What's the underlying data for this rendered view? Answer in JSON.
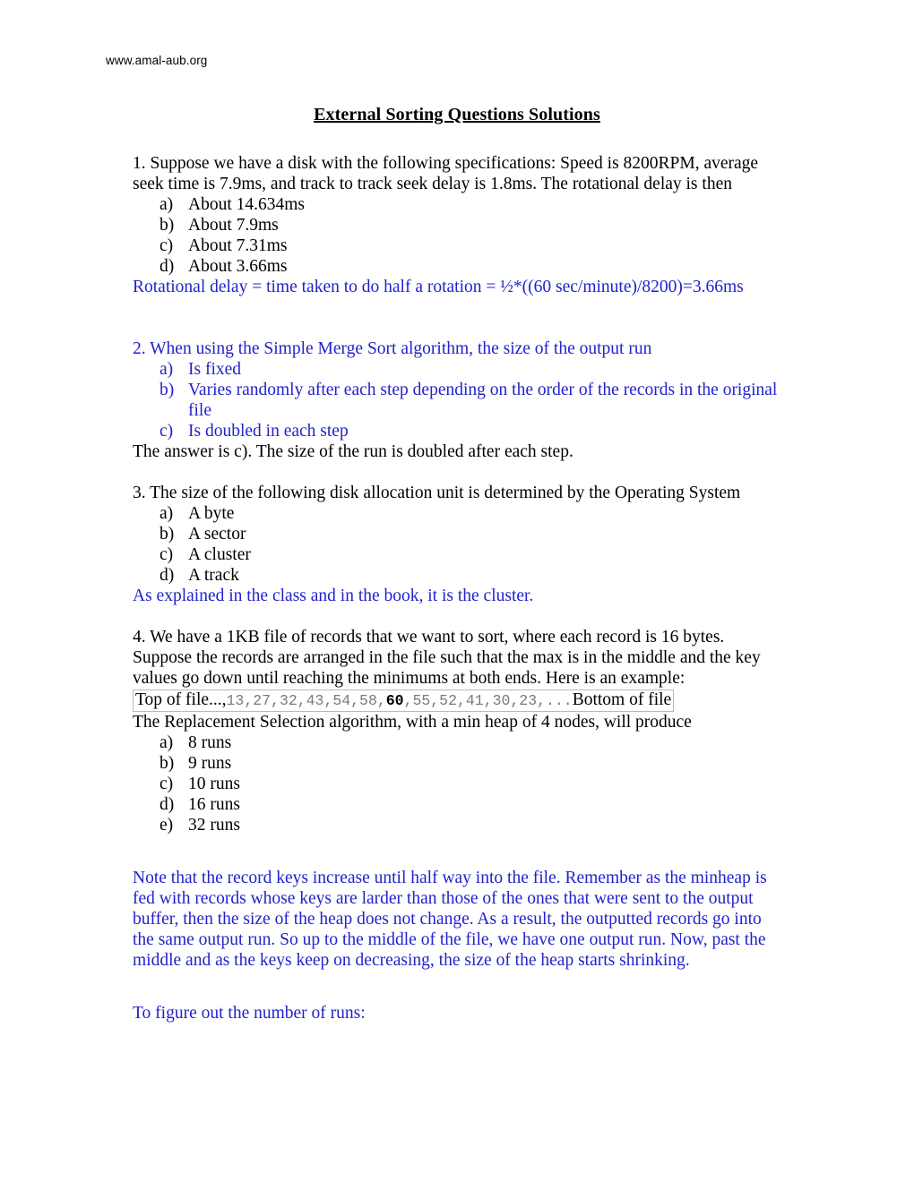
{
  "header": {
    "site_url": "www.amal-aub.org"
  },
  "document": {
    "title": "External Sorting Questions Solutions"
  },
  "colors": {
    "answer_blue": "#2222cc",
    "body_black": "#000000",
    "mono_gray": "#7a7a7a",
    "box_border": "#b9b9b9",
    "page_background": "#ffffff"
  },
  "questions": [
    {
      "number": "1",
      "stem": "1. Suppose we have a disk with the following specifications: Speed is 8200RPM, average seek time is 7.9ms, and track to track seek delay is 1.8ms. The rotational delay is then",
      "stem_color": "black",
      "choices": [
        {
          "marker": "a)",
          "text": "About 14.634ms",
          "color": "black"
        },
        {
          "marker": "b)",
          "text": "About 7.9ms",
          "color": "black"
        },
        {
          "marker": "c)",
          "text": "About 7.31ms",
          "color": "black"
        },
        {
          "marker": "d)",
          "text": "About 3.66ms",
          "color": "black"
        }
      ],
      "answer": "Rotational delay = time taken to do half a rotation = ½*((60 sec/minute)/8200)=3.66ms",
      "answer_color": "blue"
    },
    {
      "number": "2",
      "stem": "2. When using the Simple Merge Sort algorithm, the size of the output run",
      "stem_color": "blue",
      "choices": [
        {
          "marker": "a)",
          "text": "Is fixed",
          "color": "blue"
        },
        {
          "marker": "b)",
          "text": "Varies randomly after each step depending on the order of the records in the original file",
          "color": "blue"
        },
        {
          "marker": "c)",
          "text": "Is doubled in each step",
          "color": "blue"
        }
      ],
      "answer": "The answer is c). The size of the run is doubled after each step.",
      "answer_color": "black"
    },
    {
      "number": "3",
      "stem": "3. The size of the following disk allocation unit is determined by the Operating System",
      "stem_color": "black",
      "choices": [
        {
          "marker": "a)",
          "text": "A byte",
          "color": "black"
        },
        {
          "marker": "b)",
          "text": "A sector",
          "color": "black"
        },
        {
          "marker": "c)",
          "text": "A cluster",
          "color": "black"
        },
        {
          "marker": "d)",
          "text": "A track",
          "color": "black"
        }
      ],
      "answer": "As explained in the class and in the book, it is the cluster.",
      "answer_color": "blue"
    },
    {
      "number": "4",
      "stem": "4. We have a 1KB file of records that we want to sort, where each record is 16 bytes. Suppose the records are arranged in the file such that the max is in the middle and the key values go down until reaching the minimums at both ends. Here is an example:",
      "stem_color": "black",
      "file_example": {
        "prefix": "Top of file...,",
        "sequence_before": "13,27,32,43,54,58,",
        "highlighted_value": "60",
        "sequence_after": ",55,52,41,30,23,...",
        "suffix": "Bottom of file",
        "values": [
          13,
          27,
          32,
          43,
          54,
          58,
          60,
          55,
          52,
          41,
          30,
          23
        ],
        "max_value": 60
      },
      "stem_continued": "The Replacement Selection algorithm, with a min heap of 4 nodes, will produce",
      "choices": [
        {
          "marker": "a)",
          "text": "8 runs",
          "color": "black"
        },
        {
          "marker": "b)",
          "text": "9 runs",
          "color": "black"
        },
        {
          "marker": "c)",
          "text": "10 runs",
          "color": "black"
        },
        {
          "marker": "d)",
          "text": "16 runs",
          "color": "black"
        },
        {
          "marker": "e)",
          "text": "32 runs",
          "color": "black"
        }
      ],
      "explanation": "Note that the record keys increase until half way into the file. Remember as the minheap is fed with records whose keys are larder than those of the ones that were sent to the output buffer, then the size of the heap does not change. As a result, the outputted records go into the same output run. So up to the middle of the file, we have one output run. Now, past the middle and as the keys keep on decreasing, the size of the heap starts shrinking.",
      "explanation_color": "blue",
      "closing_line": "To figure out the number of runs:",
      "closing_color": "blue"
    }
  ]
}
